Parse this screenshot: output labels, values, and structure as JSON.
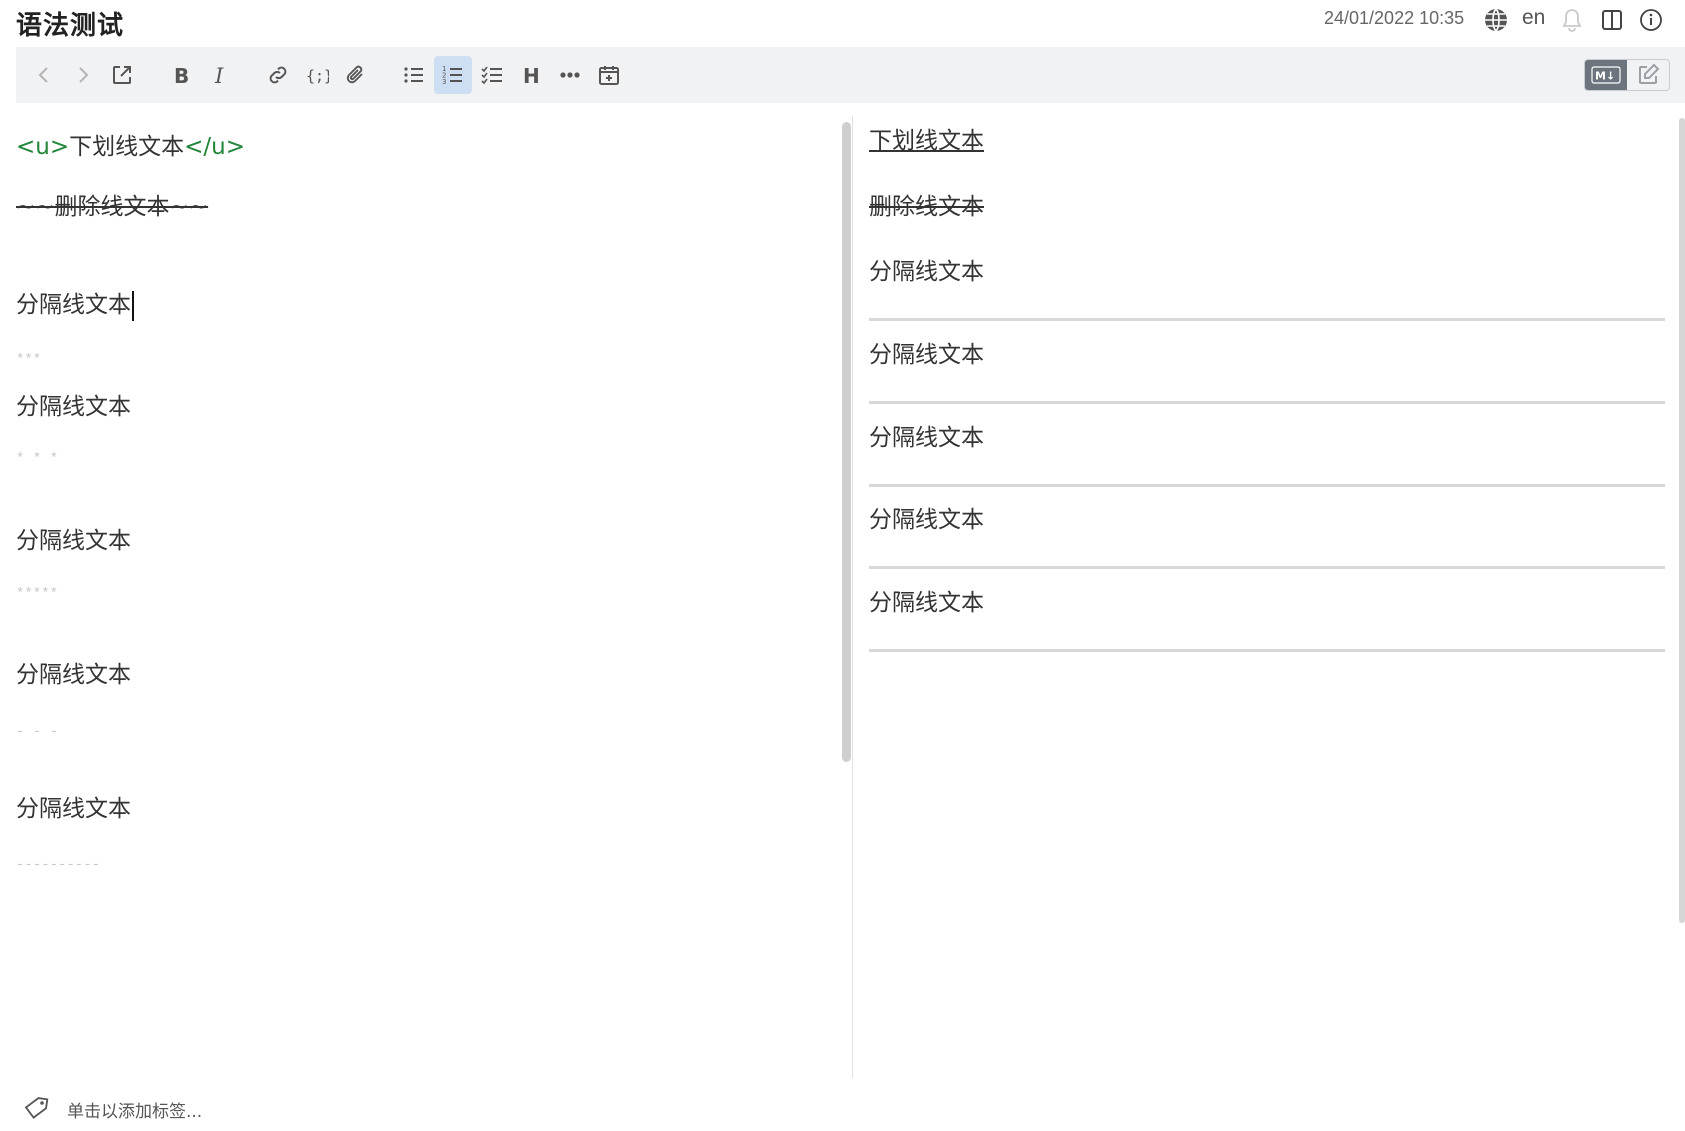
{
  "header": {
    "title": "语法测试",
    "date": "24/01/2022 10:35",
    "language": "en",
    "icons": [
      "globe-icon",
      "bell-icon",
      "split-view-icon",
      "info-icon"
    ]
  },
  "toolbar": {
    "buttons": [
      "back-icon",
      "forward-icon",
      "open-external-icon",
      "bold-icon",
      "italic-icon",
      "link-icon",
      "code-icon",
      "attachment-icon",
      "bullet-list-icon",
      "numbered-list-icon",
      "checklist-icon",
      "heading-icon",
      "more-icon",
      "insert-date-icon"
    ],
    "active_button": "numbered-list-icon",
    "mode_markdown_label": "M↓",
    "accent": "#cfdff3"
  },
  "editor": {
    "underline": {
      "open_tag": "<u>",
      "text": "下划线文本",
      "close_tag": "</u>"
    },
    "strikethrough": "~~删除线文本~~",
    "blocks": [
      {
        "text": "分隔线文本",
        "rule": "***"
      },
      {
        "text": "分隔线文本",
        "rule": "* * *"
      },
      {
        "text": "分隔线文本",
        "rule": "*****"
      },
      {
        "text": "分隔线文本",
        "rule": "- - -"
      },
      {
        "text": "分隔线文本",
        "rule": "----------"
      }
    ]
  },
  "preview": {
    "underline": "下划线文本",
    "strikethrough": "删除线文本",
    "blocks": [
      "分隔线文本",
      "分隔线文本",
      "分隔线文本",
      "分隔线文本",
      "分隔线文本"
    ]
  },
  "footer": {
    "tag_placeholder": "单击以添加标签..."
  }
}
